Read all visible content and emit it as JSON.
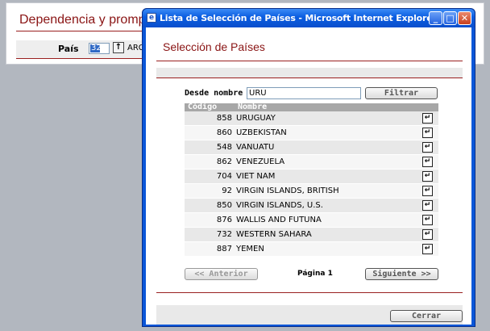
{
  "background": {
    "title": "Dependencia y prompt",
    "pais_label": "País",
    "pais_code": "32",
    "pais_name": "ARGE"
  },
  "window": {
    "title": "Lista de Selección de Países - Microsoft Internet Explorer",
    "controls": {
      "minimize": "_",
      "maximize": "□",
      "close": "✕"
    }
  },
  "dialog": {
    "heading": "Selección de Países",
    "search_label": "Desde nombre",
    "search_value": "URU",
    "filter_button": "Filtrar",
    "columns": [
      "Código",
      "Nombre"
    ],
    "rows": [
      {
        "code": "858",
        "name": "URUGUAY"
      },
      {
        "code": "860",
        "name": "UZBEKISTAN"
      },
      {
        "code": "548",
        "name": "VANUATU"
      },
      {
        "code": "862",
        "name": "VENEZUELA"
      },
      {
        "code": "704",
        "name": "VIET NAM"
      },
      {
        "code": "92",
        "name": "VIRGIN ISLANDS, BRITISH"
      },
      {
        "code": "850",
        "name": "VIRGIN ISLANDS, U.S."
      },
      {
        "code": "876",
        "name": "WALLIS AND FUTUNA"
      },
      {
        "code": "732",
        "name": "WESTERN SAHARA"
      },
      {
        "code": "887",
        "name": "YEMEN"
      }
    ],
    "select_glyph": "↵",
    "prev_button": "<< Anterior",
    "page_label": "Página 1",
    "next_button": "Siguiente >>",
    "close_button": "Cerrar"
  }
}
